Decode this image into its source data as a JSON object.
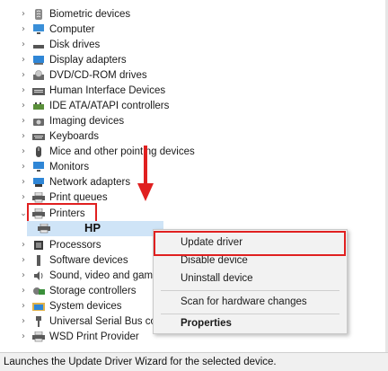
{
  "tree": {
    "items": [
      {
        "label": "Biometric devices",
        "icon": "fingerprint-icon",
        "expander": ">"
      },
      {
        "label": "Computer",
        "icon": "monitor-icon",
        "expander": ">"
      },
      {
        "label": "Disk drives",
        "icon": "disk-drive-icon",
        "expander": ">"
      },
      {
        "label": "Display adapters",
        "icon": "display-adapter-icon",
        "expander": ">"
      },
      {
        "label": "DVD/CD-ROM drives",
        "icon": "dvd-drive-icon",
        "expander": ">"
      },
      {
        "label": "Human Interface Devices",
        "icon": "hid-icon",
        "expander": ">"
      },
      {
        "label": "IDE ATA/ATAPI controllers",
        "icon": "ide-controller-icon",
        "expander": ">"
      },
      {
        "label": "Imaging devices",
        "icon": "camera-icon",
        "expander": ">"
      },
      {
        "label": "Keyboards",
        "icon": "keyboard-icon",
        "expander": ">"
      },
      {
        "label": "Mice and other pointing devices",
        "icon": "mouse-icon",
        "expander": ">"
      },
      {
        "label": "Monitors",
        "icon": "monitor-icon",
        "expander": ">"
      },
      {
        "label": "Network adapters",
        "icon": "network-adapter-icon",
        "expander": ">"
      },
      {
        "label": "Print queues",
        "icon": "printer-icon",
        "expander": ">"
      },
      {
        "label": "Printers",
        "icon": "printer-icon",
        "expander": "v"
      }
    ],
    "child": {
      "label": "HP",
      "icon": "printer-icon"
    },
    "items_after": [
      {
        "label": "Processors",
        "icon": "processor-icon",
        "expander": ">"
      },
      {
        "label": "Software devices",
        "icon": "software-device-icon",
        "expander": ">"
      },
      {
        "label": "Sound, video and game controllers",
        "icon": "speaker-icon",
        "expander": ">"
      },
      {
        "label": "Storage controllers",
        "icon": "storage-controller-icon",
        "expander": ">"
      },
      {
        "label": "System devices",
        "icon": "folder-icon",
        "expander": ">"
      },
      {
        "label": "Universal Serial Bus controllers",
        "icon": "usb-icon",
        "expander": ">"
      },
      {
        "label": "WSD Print Provider",
        "icon": "printer-icon",
        "expander": ">"
      }
    ]
  },
  "context_menu": {
    "items": [
      "Update driver",
      "Disable device",
      "Uninstall device",
      "Scan for hardware changes",
      "Properties"
    ]
  },
  "status_bar": {
    "text": "Launches the Update Driver Wizard for the selected device."
  },
  "colors": {
    "highlight_red": "#e02020",
    "selection_blue": "#cfe4f7"
  }
}
